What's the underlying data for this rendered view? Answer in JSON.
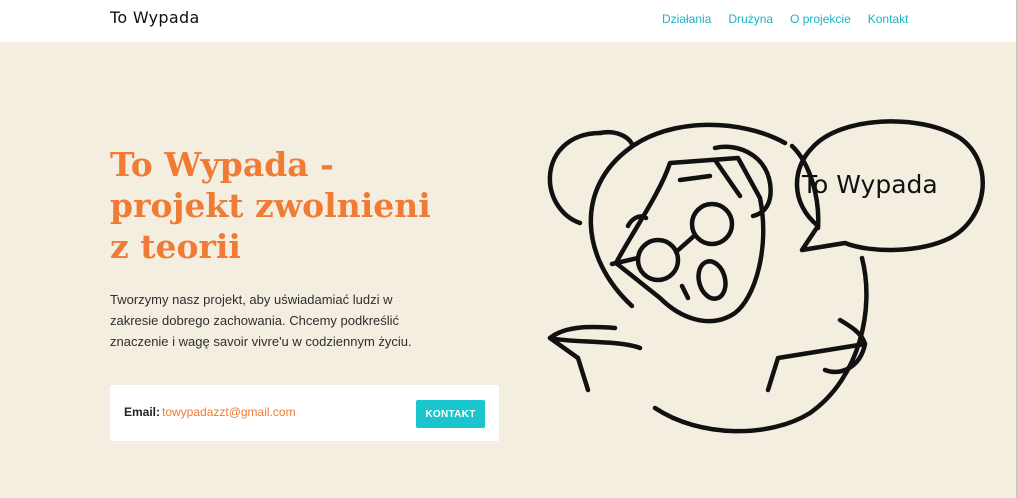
{
  "nav": {
    "logo": "To Wypada",
    "links": [
      "Działania",
      "Drużyna",
      "O projekcie",
      "Kontakt"
    ]
  },
  "hero": {
    "title_lines": [
      "To Wypada -",
      "projekt zwolnieni",
      "z teorii"
    ],
    "description": "Tworzymy nasz projekt, aby uświadamiać ludzi w zakresie dobrego zachowania. Chcemy podkreślić znaczenie i wagę savoir vivre'u w codziennym życiu."
  },
  "contact": {
    "email_label": "Email:",
    "email": "towypadazzt@gmail.com",
    "button_label": "KONTAKT"
  },
  "illustration": {
    "speech_bubble_text": "To Wypada"
  },
  "colors": {
    "background": "#f3eee0",
    "accent_orange": "#f07b35",
    "accent_teal": "#1cb3c2",
    "button_teal": "#1ac5ce"
  }
}
